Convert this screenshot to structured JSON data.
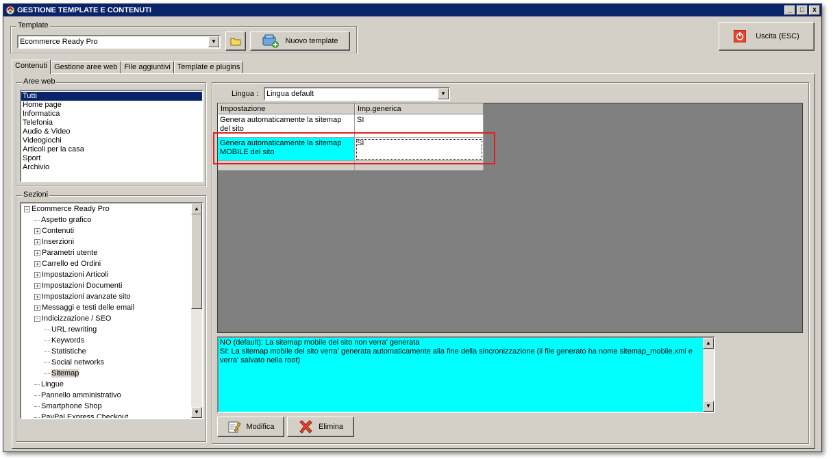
{
  "window": {
    "title": "GESTIONE TEMPLATE E CONTENUTI",
    "controls": [
      "_",
      "□",
      "x"
    ]
  },
  "template_group": {
    "label": "Template",
    "selected": "Ecommerce Ready Pro",
    "new_button": "Nuovo template"
  },
  "exit_button": "Uscita (ESC)",
  "tabs": [
    "Contenuti",
    "Gestione aree web",
    "File aggiuntivi",
    "Template e plugins"
  ],
  "aree_web": {
    "label": "Aree web",
    "items": [
      "Tutti",
      "Home page",
      "Informatica",
      "Telefonia",
      "Audio & Video",
      "Videogiochi",
      "Articoli per la casa",
      "Sport",
      "Archivio"
    ],
    "selected_index": 0
  },
  "sezioni": {
    "label": "Sezioni",
    "items": [
      {
        "label": "Ecommerce Ready Pro",
        "level": 0,
        "exp": "minus"
      },
      {
        "label": "Aspetto grafico",
        "level": 1,
        "exp": "none"
      },
      {
        "label": "Contenuti",
        "level": 1,
        "exp": "plus"
      },
      {
        "label": "Inserzioni",
        "level": 1,
        "exp": "plus"
      },
      {
        "label": "Parametri utente",
        "level": 1,
        "exp": "plus"
      },
      {
        "label": "Carrello ed Ordini",
        "level": 1,
        "exp": "plus"
      },
      {
        "label": "Impostazioni Articoli",
        "level": 1,
        "exp": "plus"
      },
      {
        "label": "Impostazioni Documenti",
        "level": 1,
        "exp": "plus"
      },
      {
        "label": "Impostazioni avanzate sito",
        "level": 1,
        "exp": "plus"
      },
      {
        "label": "Messaggi e testi delle email",
        "level": 1,
        "exp": "plus"
      },
      {
        "label": "Indicizzazione / SEO",
        "level": 1,
        "exp": "minus"
      },
      {
        "label": "URL rewriting",
        "level": 2,
        "exp": "none"
      },
      {
        "label": "Keywords",
        "level": 2,
        "exp": "none"
      },
      {
        "label": "Statistiche",
        "level": 2,
        "exp": "none"
      },
      {
        "label": "Social networks",
        "level": 2,
        "exp": "none"
      },
      {
        "label": "Sitemap",
        "level": 2,
        "exp": "none",
        "selected": true
      },
      {
        "label": "Lingue",
        "level": 1,
        "exp": "none"
      },
      {
        "label": "Pannello amministrativo",
        "level": 1,
        "exp": "none"
      },
      {
        "label": "Smartphone Shop",
        "level": 1,
        "exp": "none"
      },
      {
        "label": "PayPal Express Checkout",
        "level": 1,
        "exp": "none"
      }
    ]
  },
  "lingua": {
    "label": "Lingua :",
    "selected": "Lingua default"
  },
  "grid": {
    "headers": [
      "Impostazione",
      "Imp.generica"
    ],
    "rows": [
      {
        "setting": "Genera automaticamente la sitemap del sito",
        "value": "SI"
      },
      {
        "setting": "Genera automaticamente la sitemap MOBILE del sito",
        "value": "SI"
      }
    ]
  },
  "description": {
    "line1": "NO (default): La sitemap mobile del sito non verra' generata",
    "line2": "SI: La sitemap mobile del sito verra' generata automaticamente alla fine della sincronizzazione (il file generato ha nome sitemap_mobile.xml e verra' salvato nella root)"
  },
  "actions": {
    "modifica": "Modifica",
    "elimina": "Elimina"
  },
  "colors": {
    "title_bar": "#0a246a",
    "window_bg": "#d4d0c8",
    "cyan": "#00ffff",
    "highlight": "#e02020"
  }
}
